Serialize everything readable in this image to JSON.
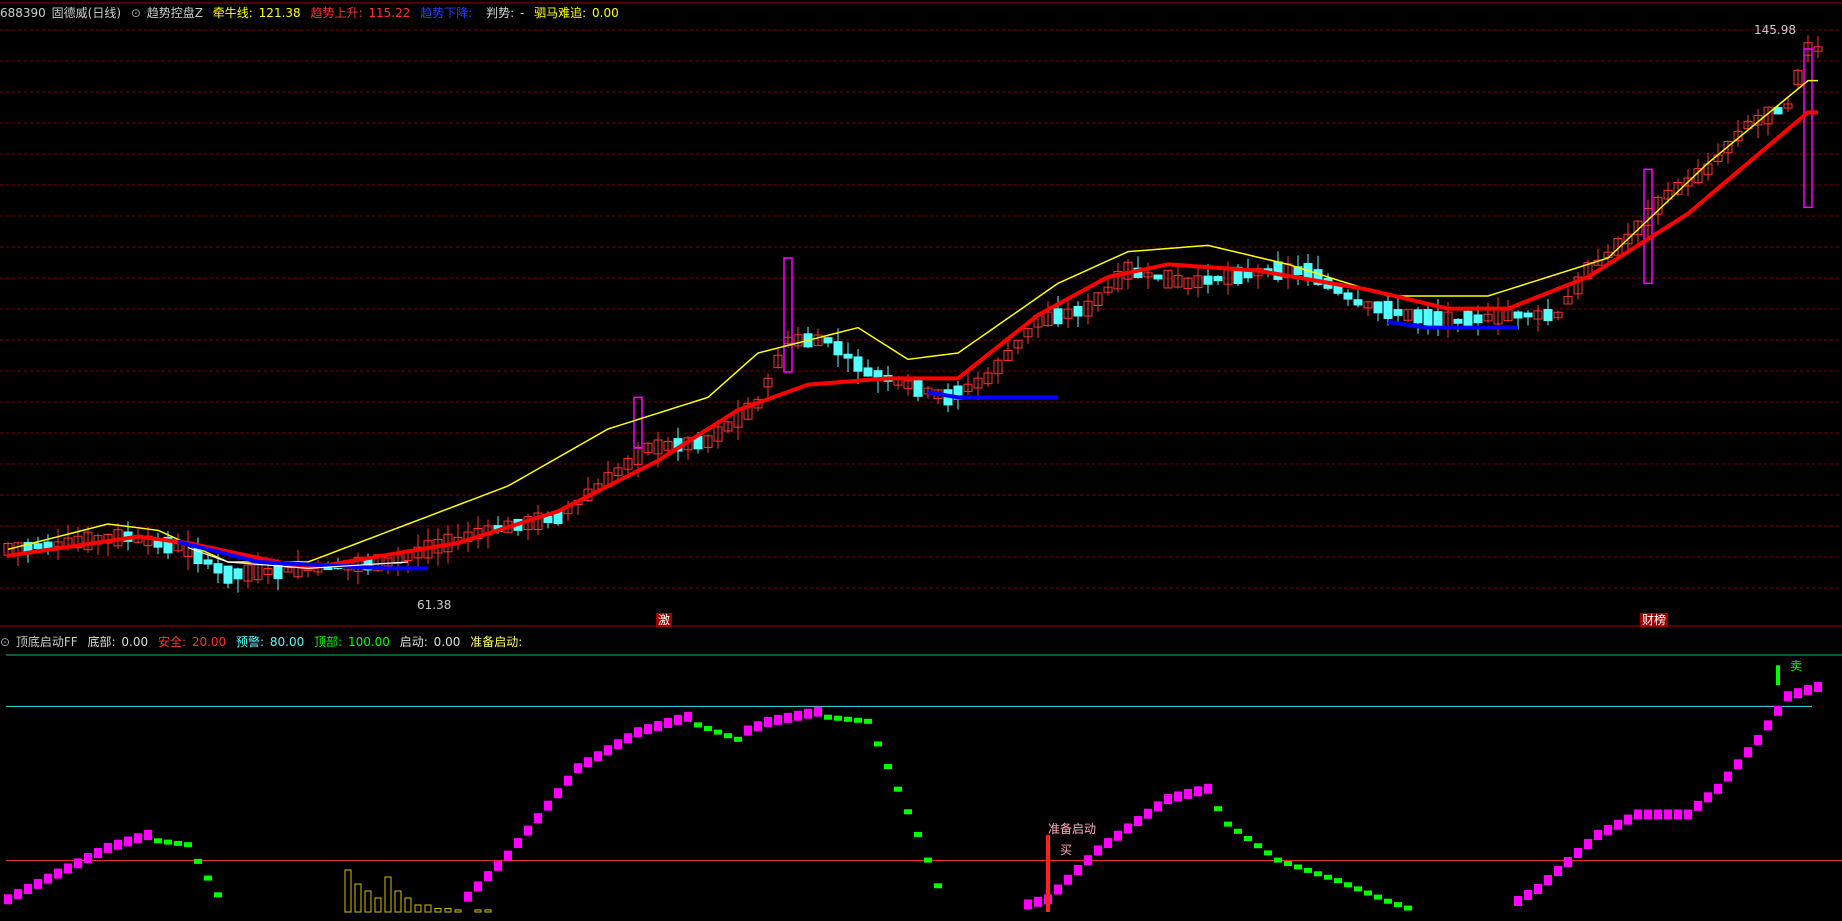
{
  "main_header": {
    "code": "688390",
    "name": "固德威(日线)",
    "indicator_name": "趋势控盘Z",
    "bull_label": "牵牛线:",
    "bull_value": "121.38",
    "up_label": "趋势上升:",
    "up_value": "115.22",
    "down_label": "趋势下降:",
    "judge_label": "判势:",
    "judge_value": "-",
    "horse_label": "驷马难追:",
    "horse_value": "0.00"
  },
  "sub_header": {
    "indicator_name": "顶底启动FF",
    "bottom_label": "底部:",
    "bottom_value": "0.00",
    "safe_label": "安全:",
    "safe_value": "20.00",
    "warn_label": "预警:",
    "warn_value": "80.00",
    "top_label": "顶部:",
    "top_value": "100.00",
    "start_label": "启动:",
    "start_value": "0.00",
    "ready_label": "准备启动:"
  },
  "annotations": {
    "high_price": "145.98",
    "low_price": "61.38",
    "tag_ji": "激",
    "tag_caibao": "财榜",
    "ready_start": "准备启动",
    "buy": "买",
    "sell": "卖"
  },
  "colors": {
    "background": "#000000",
    "up_candle": "#ff3232",
    "down_candle": "#54ffff",
    "bull_line": "#ffff00",
    "short_line": "#ffffff",
    "trend_up": "#ff0000",
    "trend_down": "#0000ff",
    "osc_up": "#ff00ff",
    "osc_down": "#00ff00",
    "grid": "#7a0000"
  },
  "chart_data": [
    {
      "type": "candlestick",
      "title": "趋势控盘Z",
      "ylim": [
        61.38,
        145.98
      ],
      "series": [
        {
          "name": "牵牛线",
          "values_anchor": [
            [
              0,
              66
            ],
            [
              10,
              70
            ],
            [
              15,
              69
            ],
            [
              22,
              64
            ],
            [
              30,
              64
            ],
            [
              40,
              70
            ],
            [
              50,
              76
            ],
            [
              60,
              85
            ],
            [
              70,
              90
            ],
            [
              75,
              97
            ],
            [
              85,
              101
            ],
            [
              90,
              96
            ],
            [
              95,
              97
            ],
            [
              105,
              108
            ],
            [
              112,
              113
            ],
            [
              120,
              114
            ],
            [
              128,
              111
            ],
            [
              138,
              106
            ],
            [
              148,
              106
            ],
            [
              160,
              112
            ],
            [
              170,
              127
            ],
            [
              180,
              140
            ]
          ]
        },
        {
          "name": "趋势上升",
          "values_anchor": [
            [
              0,
              65
            ],
            [
              13,
              68
            ],
            [
              18,
              67
            ],
            [
              30,
              63
            ],
            [
              45,
              67
            ],
            [
              55,
              72
            ],
            [
              65,
              80
            ],
            [
              73,
              88
            ],
            [
              80,
              92
            ],
            [
              88,
              93
            ],
            [
              95,
              93
            ],
            [
              103,
              103
            ],
            [
              110,
              109
            ],
            [
              116,
              111
            ],
            [
              125,
              110
            ],
            [
              136,
              107
            ],
            [
              144,
              104
            ],
            [
              150,
              104
            ],
            [
              158,
              109
            ],
            [
              168,
              119
            ],
            [
              180,
              135
            ]
          ]
        },
        {
          "name": "趋势下降",
          "values_anchor": [
            [
              15,
              68
            ],
            [
              25,
              64
            ],
            [
              38,
              63
            ],
            [
              80,
              94
            ],
            [
              95,
              90
            ],
            [
              123,
              108
            ],
            [
              133,
              103
            ],
            [
              142,
              101
            ]
          ]
        }
      ],
      "candles_anchor": [
        [
          0,
          66
        ],
        [
          12,
          68
        ],
        [
          18,
          66
        ],
        [
          22,
          62
        ],
        [
          30,
          63
        ],
        [
          38,
          64
        ],
        [
          42,
          66
        ],
        [
          48,
          69
        ],
        [
          55,
          71
        ],
        [
          60,
          77
        ],
        [
          64,
          82
        ],
        [
          70,
          83
        ],
        [
          75,
          89
        ],
        [
          78,
          99
        ],
        [
          82,
          99
        ],
        [
          86,
          94
        ],
        [
          90,
          92
        ],
        [
          94,
          90
        ],
        [
          98,
          93
        ],
        [
          103,
          102
        ],
        [
          108,
          104
        ],
        [
          112,
          110
        ],
        [
          118,
          108
        ],
        [
          122,
          109
        ],
        [
          126,
          110
        ],
        [
          130,
          110
        ],
        [
          135,
          105
        ],
        [
          140,
          103
        ],
        [
          145,
          102
        ],
        [
          150,
          103
        ],
        [
          155,
          103
        ],
        [
          158,
          110
        ],
        [
          162,
          115
        ],
        [
          166,
          122
        ],
        [
          170,
          126
        ],
        [
          174,
          133
        ],
        [
          178,
          136
        ],
        [
          180,
          145
        ]
      ]
    },
    {
      "type": "bar",
      "title": "顶底启动FF",
      "ylim": [
        0,
        100
      ],
      "levels": [
        20,
        80,
        100
      ],
      "values_anchor": [
        [
          0,
          3
        ],
        [
          10,
          23
        ],
        [
          14,
          28
        ],
        [
          18,
          26
        ],
        [
          22,
          0
        ],
        [
          45,
          0
        ],
        [
          50,
          20
        ],
        [
          57,
          54
        ],
        [
          63,
          68
        ],
        [
          68,
          74
        ],
        [
          73,
          67
        ],
        [
          76,
          72
        ],
        [
          81,
          76
        ],
        [
          86,
          74
        ],
        [
          91,
          30
        ],
        [
          94,
          0
        ],
        [
          101,
          0
        ],
        [
          104,
          3
        ],
        [
          109,
          22
        ],
        [
          116,
          42
        ],
        [
          120,
          46
        ],
        [
          122,
          34
        ],
        [
          127,
          20
        ],
        [
          133,
          12
        ],
        [
          138,
          4
        ],
        [
          141,
          0
        ],
        [
          150,
          0
        ],
        [
          153,
          7
        ],
        [
          159,
          28
        ],
        [
          163,
          36
        ],
        [
          168,
          36
        ],
        [
          171,
          46
        ],
        [
          175,
          65
        ],
        [
          178,
          82
        ],
        [
          183,
          88
        ]
      ],
      "yellow_bars": [
        [
          34,
          6
        ],
        [
          35,
          4
        ],
        [
          36,
          3
        ],
        [
          37,
          2
        ],
        [
          38,
          5
        ],
        [
          39,
          3
        ],
        [
          40,
          2
        ],
        [
          41,
          1
        ],
        [
          42,
          1
        ],
        [
          43,
          0.5
        ],
        [
          44,
          0.5
        ],
        [
          45,
          0.3
        ],
        [
          47,
          0.3
        ],
        [
          48,
          0.3
        ]
      ]
    }
  ]
}
